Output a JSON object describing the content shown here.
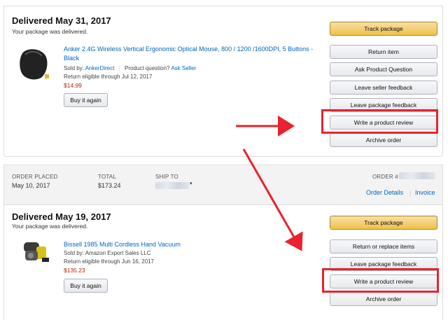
{
  "order1": {
    "status": "Delivered May 31, 2017",
    "status_sub": "Your package was delivered.",
    "product_title": "Anker 2.4G Wireless Vertical Ergonomic Optical Mouse, 800 / 1200 /1600DPI, 5 Buttons - Black",
    "sold_by_label": "Sold by:",
    "sold_by": "AnkerDirect",
    "question_label": "Product question?",
    "ask_seller": "Ask Seller",
    "return_eligible": "Return eligible through Jul 12, 2017",
    "price": "$14.99",
    "buy_again": "Buy it again",
    "buttons": [
      "Track package",
      "Return item",
      "Ask Product Question",
      "Leave seller feedback",
      "Leave package feedback",
      "Write a product review",
      "Archive order"
    ]
  },
  "order2_header": {
    "order_placed_label": "ORDER PLACED",
    "order_placed": "May 10, 2017",
    "total_label": "TOTAL",
    "total": "$173.24",
    "ship_to_label": "SHIP TO",
    "order_label": "ORDER #",
    "order_details": "Order Details",
    "invoice": "Invoice"
  },
  "order2": {
    "status": "Delivered May 19, 2017",
    "status_sub": "Your package was delivered.",
    "product_title": "Bissell 1985 Multi Cordless Hand Vacuum",
    "sold_by": "Sold by: Amazon Export Sales LLC",
    "return_eligible": "Return eligible through Jun 16, 2017",
    "price": "$135.23",
    "buy_again": "Buy it again",
    "buttons": [
      "Track package",
      "Return or replace items",
      "Leave package feedback",
      "Write a product review",
      "Archive order"
    ]
  },
  "colors": {
    "accent_red": "#e8232e",
    "link_blue": "#0066c0",
    "price_red": "#b12704",
    "primary_button": "#f0c14b"
  }
}
